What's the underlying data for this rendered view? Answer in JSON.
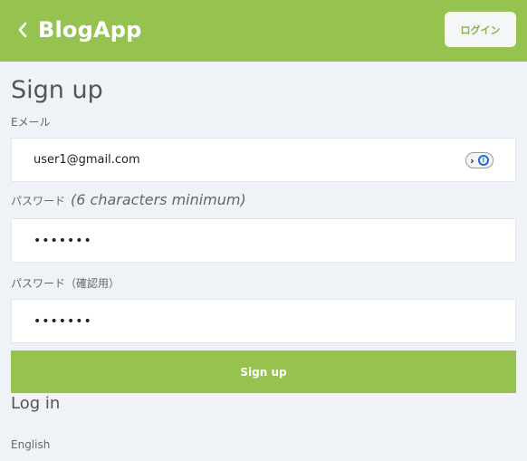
{
  "header": {
    "brand": "BlogApp",
    "login_button": "ログイン"
  },
  "form": {
    "title": "Sign up",
    "email_label": "Eメール",
    "email_value": "user1@gmail.com",
    "password_label": "パスワード",
    "password_hint": "(6 characters minimum)",
    "password_value": "•••••••",
    "password_confirm_label": "パスワード（確認用）",
    "password_confirm_value": "•••••••",
    "submit_label": "Sign up"
  },
  "links": {
    "login": "Log in",
    "language": "English"
  },
  "colors": {
    "accent": "#96c34f",
    "background": "#eff3f7"
  },
  "icons": {
    "back": "chevron-left-icon",
    "password_manager": "password-manager-icon"
  }
}
